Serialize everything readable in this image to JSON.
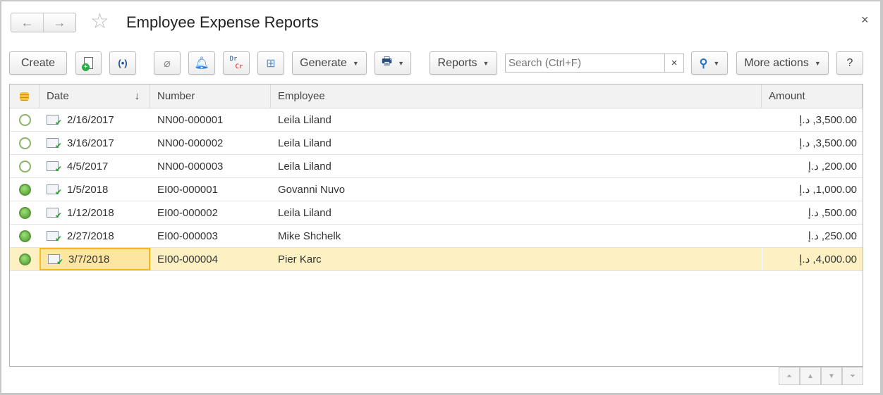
{
  "window": {
    "title": "Employee Expense Reports",
    "close": "×"
  },
  "nav": {
    "back": "←",
    "forward": "→",
    "favorite": "☆"
  },
  "toolbar": {
    "create": "Create",
    "generate": "Generate",
    "reports": "Reports",
    "more_actions": "More actions",
    "help": "?",
    "dr": "Dr",
    "cr": "Cr"
  },
  "search": {
    "placeholder": "Search (Ctrl+F)",
    "value": "",
    "clear": "×"
  },
  "table": {
    "headers": {
      "date": "Date",
      "number": "Number",
      "employee": "Employee",
      "amount": "Amount",
      "sort": "↓"
    },
    "rows": [
      {
        "posted": false,
        "date": "2/16/2017",
        "number": "NN00-000001",
        "employee": "Leila Liland",
        "amount": "3,500.00, د.إ"
      },
      {
        "posted": false,
        "date": "3/16/2017",
        "number": "NN00-000002",
        "employee": "Leila Liland",
        "amount": "3,500.00, د.إ"
      },
      {
        "posted": false,
        "date": "4/5/2017",
        "number": "NN00-000003",
        "employee": "Leila Liland",
        "amount": "200.00, د.إ"
      },
      {
        "posted": true,
        "date": "1/5/2018",
        "number": "EI00-000001",
        "employee": "Govanni Nuvo",
        "amount": "1,000.00, د.إ"
      },
      {
        "posted": true,
        "date": "1/12/2018",
        "number": "EI00-000002",
        "employee": "Leila Liland",
        "amount": "500.00, د.إ"
      },
      {
        "posted": true,
        "date": "2/27/2018",
        "number": "EI00-000003",
        "employee": "Mike Shchelk",
        "amount": "250.00, د.إ"
      },
      {
        "posted": true,
        "date": "3/7/2018",
        "number": "EI00-000004",
        "employee": "Pier Karc",
        "amount": "4,000.00, د.إ",
        "selected": true
      }
    ]
  }
}
